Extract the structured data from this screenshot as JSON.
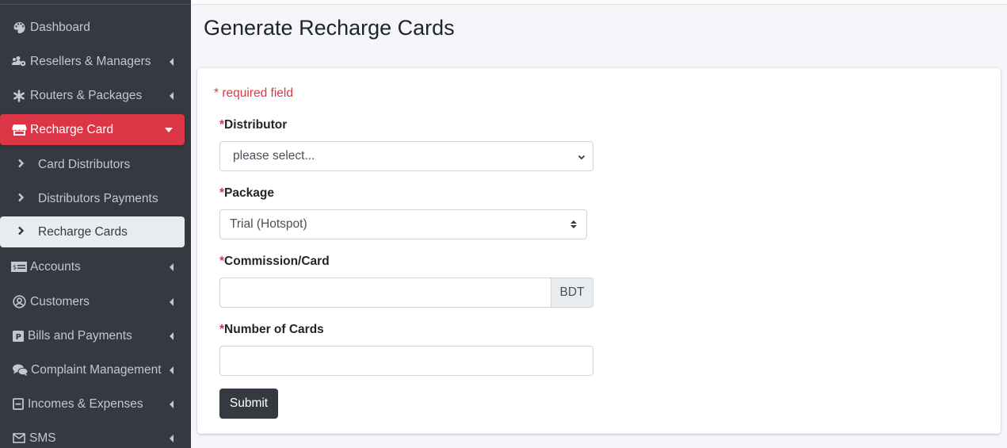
{
  "sidebar": {
    "items": [
      {
        "label": "Dashboard",
        "icon": "palette-icon",
        "has_caret": false
      },
      {
        "label": "Resellers & Managers",
        "icon": "users-cog-icon",
        "has_caret": true
      },
      {
        "label": "Routers & Packages",
        "icon": "asterisk-icon",
        "has_caret": true
      },
      {
        "label": "Recharge Card",
        "icon": "store-icon",
        "has_caret": true,
        "active": true
      },
      {
        "label": "Accounts",
        "icon": "money-check-icon",
        "has_caret": true
      },
      {
        "label": "Customers",
        "icon": "user-circle-icon",
        "has_caret": true
      },
      {
        "label": "Bills and Payments",
        "icon": "parking-icon",
        "has_caret": true
      },
      {
        "label": "Complaint Management",
        "icon": "comments-icon",
        "has_caret": true
      },
      {
        "label": "Incomes & Expenses",
        "icon": "minus-square-icon",
        "has_caret": true
      },
      {
        "label": "SMS",
        "icon": "envelope-icon",
        "has_caret": true
      }
    ],
    "subitems": [
      {
        "label": "Card Distributors"
      },
      {
        "label": "Distributors Payments"
      },
      {
        "label": "Recharge Cards",
        "current": true
      }
    ]
  },
  "page": {
    "title": "Generate Recharge Cards"
  },
  "form": {
    "required_note": "* required field",
    "required_marker": "*",
    "distributor": {
      "label": "Distributor",
      "value": "please select..."
    },
    "package": {
      "label": "Package",
      "value": "Trial (Hotspot)"
    },
    "commission": {
      "label": "Commission/Card",
      "value": "",
      "addon": "BDT"
    },
    "num_cards": {
      "label": "Number of Cards",
      "value": ""
    },
    "submit_label": "Submit"
  },
  "colors": {
    "sidebar_bg": "#343a40",
    "active_item": "#dc3545",
    "required": "#dc3545",
    "button_bg": "#343a40"
  }
}
